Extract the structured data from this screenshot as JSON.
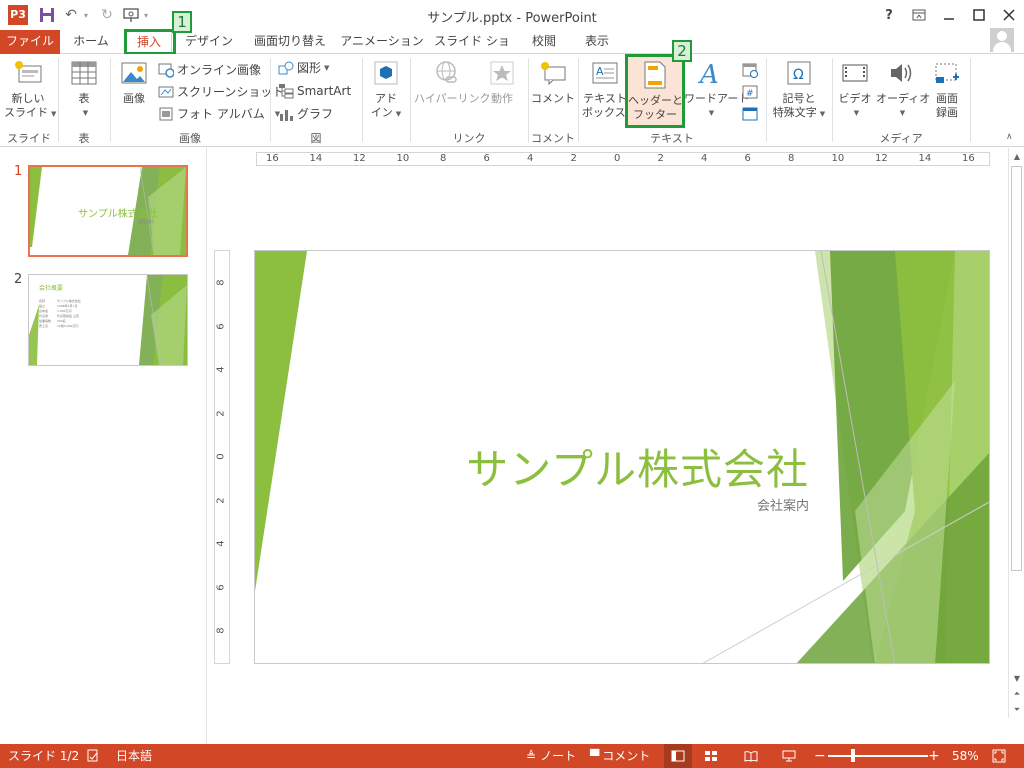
{
  "app": {
    "logo_label": "P3",
    "window_title": "サンプル.pptx - PowerPoint"
  },
  "window_controls": {
    "help": "?",
    "ribbon_display": "⇱",
    "minimize": "—",
    "maximize": "☐",
    "close": "✕"
  },
  "tabs": [
    {
      "id": "file",
      "label": "ファイル"
    },
    {
      "id": "home",
      "label": "ホーム"
    },
    {
      "id": "insert",
      "label": "挿入"
    },
    {
      "id": "design",
      "label": "デザイン"
    },
    {
      "id": "transitions",
      "label": "画面切り替え"
    },
    {
      "id": "animations",
      "label": "アニメーション"
    },
    {
      "id": "slideshow",
      "label": "スライド ショー"
    },
    {
      "id": "review",
      "label": "校閲"
    },
    {
      "id": "view",
      "label": "表示"
    }
  ],
  "active_tab": "挿入",
  "callouts": [
    "1",
    "2"
  ],
  "ribbon": {
    "new_slide": [
      "新しい",
      "スライド"
    ],
    "table": "表",
    "image": "画像",
    "online_image": "オンライン画像",
    "screenshot": "スクリーンショット",
    "photo_album": "フォト アルバム",
    "shapes": "図形",
    "smartart": "SmartArt",
    "chart": "グラフ",
    "addins": [
      "アド",
      "イン"
    ],
    "hyperlink": "ハイパーリンク",
    "action": "動作",
    "comment": "コメント",
    "textbox": [
      "テキスト",
      "ボックス"
    ],
    "header_footer": [
      "ヘッダーと",
      "フッター"
    ],
    "wordart": "ワードアート",
    "symbols": [
      "記号と",
      "特殊文字"
    ],
    "video": "ビデオ",
    "audio": "オーディオ",
    "screen_record": [
      "画面",
      "録画"
    ],
    "groups": {
      "slides": "スライド",
      "tables": "表",
      "images": "画像",
      "illustrations": "図",
      "links": "リンク",
      "comments": "コメント",
      "text": "テキスト",
      "media": "メディア"
    }
  },
  "thumbnails": [
    {
      "num": "1",
      "title": "サンプル株式会社",
      "subtitle": "会社案内"
    },
    {
      "num": "2",
      "title": "会社概要",
      "lines": [
        "名称　　　　サンプル株式会社",
        "設立　　　　1998年4月1日",
        "資本金　　　1,000万円",
        "代表者　　　代表取締役 山田",
        "従業員数　　200名",
        "売上高　　　10億5,000万円"
      ]
    }
  ],
  "ruler": {
    "h": [
      "16",
      "14",
      "12",
      "10",
      "8",
      "6",
      "4",
      "2",
      "0",
      "2",
      "4",
      "6",
      "8",
      "10",
      "12",
      "14",
      "16"
    ],
    "v": [
      "8",
      "6",
      "4",
      "2",
      "0",
      "2",
      "4",
      "6",
      "8"
    ]
  },
  "slide": {
    "title": "サンプル株式会社",
    "subtitle": "会社案内"
  },
  "status": {
    "slide_indicator": "スライド 1/2",
    "language": "日本語",
    "notes": "ノート",
    "comments": "コメント",
    "zoom": "58%"
  },
  "colors": {
    "accent": "#d24726",
    "highlight": "#1f9b37",
    "slide_green": "#8cbf3f"
  }
}
